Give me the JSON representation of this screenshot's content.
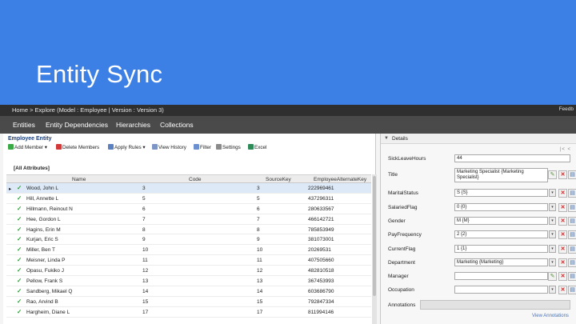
{
  "slide": {
    "title": "Entity Sync"
  },
  "app": {
    "breadcrumb": "Home > Explore (Model : Employee | Version : Version 3)",
    "top_right": "Feedb",
    "nav": [
      "Entities",
      "Entity Dependencies",
      "Hierarchies",
      "Collections"
    ],
    "entity_title": "Employee Entity",
    "toolbar": {
      "add": "Add Member",
      "delete": "Delete Members",
      "apply_rules": "Apply Rules",
      "view_history": "View History",
      "filter": "Filter",
      "settings": "Settings",
      "excel": "Excel"
    },
    "attributes_label": "[All Attributes]",
    "columns": [
      "Name",
      "Code",
      "SourceKey",
      "EmployeeAlternateKey"
    ],
    "rows": [
      {
        "name": "Wood, John L",
        "code": "3",
        "source": "3",
        "alt": "222969461"
      },
      {
        "name": "Hill, Annette L",
        "code": "5",
        "source": "5",
        "alt": "437296311"
      },
      {
        "name": "Hillmann, Reinout N",
        "code": "6",
        "source": "6",
        "alt": "280633567"
      },
      {
        "name": "Hee, Gordon L",
        "code": "7",
        "source": "7",
        "alt": "466142721"
      },
      {
        "name": "Hagins, Erin M",
        "code": "8",
        "source": "8",
        "alt": "785853949"
      },
      {
        "name": "Kurjan, Eric S",
        "code": "9",
        "source": "9",
        "alt": "381073001"
      },
      {
        "name": "Miller, Ben T",
        "code": "10",
        "source": "10",
        "alt": "20269531"
      },
      {
        "name": "Meisner, Linda P",
        "code": "11",
        "source": "11",
        "alt": "407505660"
      },
      {
        "name": "Opasu, Fukiko J",
        "code": "12",
        "source": "12",
        "alt": "482810518"
      },
      {
        "name": "Pellow, Frank S",
        "code": "13",
        "source": "13",
        "alt": "367453993"
      },
      {
        "name": "Sandberg, Mikael Q",
        "code": "14",
        "source": "14",
        "alt": "603686790"
      },
      {
        "name": "Rao, Arvind B",
        "code": "15",
        "source": "15",
        "alt": "792847334"
      },
      {
        "name": "Hargheim, Diane L",
        "code": "17",
        "source": "17",
        "alt": "811994146"
      }
    ],
    "details": {
      "title": "Details",
      "pager": "|< <",
      "fields": [
        {
          "label": "SickLeaveHours",
          "value": "44"
        },
        {
          "label": "Title",
          "value": "Marketing Specialist {Marketing Specialist}"
        },
        {
          "label": "MaritalStatus",
          "value": "S {S}"
        },
        {
          "label": "SalariedFlag",
          "value": "0 {0}"
        },
        {
          "label": "Gender",
          "value": "M {M}"
        },
        {
          "label": "PayFrequency",
          "value": "2 {2}"
        },
        {
          "label": "CurrentFlag",
          "value": "1 {1}"
        },
        {
          "label": "Department",
          "value": "Marketing {Marketing}"
        },
        {
          "label": "Manager",
          "value": ""
        },
        {
          "label": "Occupation",
          "value": ""
        }
      ],
      "annotations_label": "Annotations",
      "view_annotations": "View Annotations"
    }
  },
  "colors": {
    "banner": "#3c80e6",
    "check": "#2f9d3b",
    "delete": "#cc2a2a"
  }
}
